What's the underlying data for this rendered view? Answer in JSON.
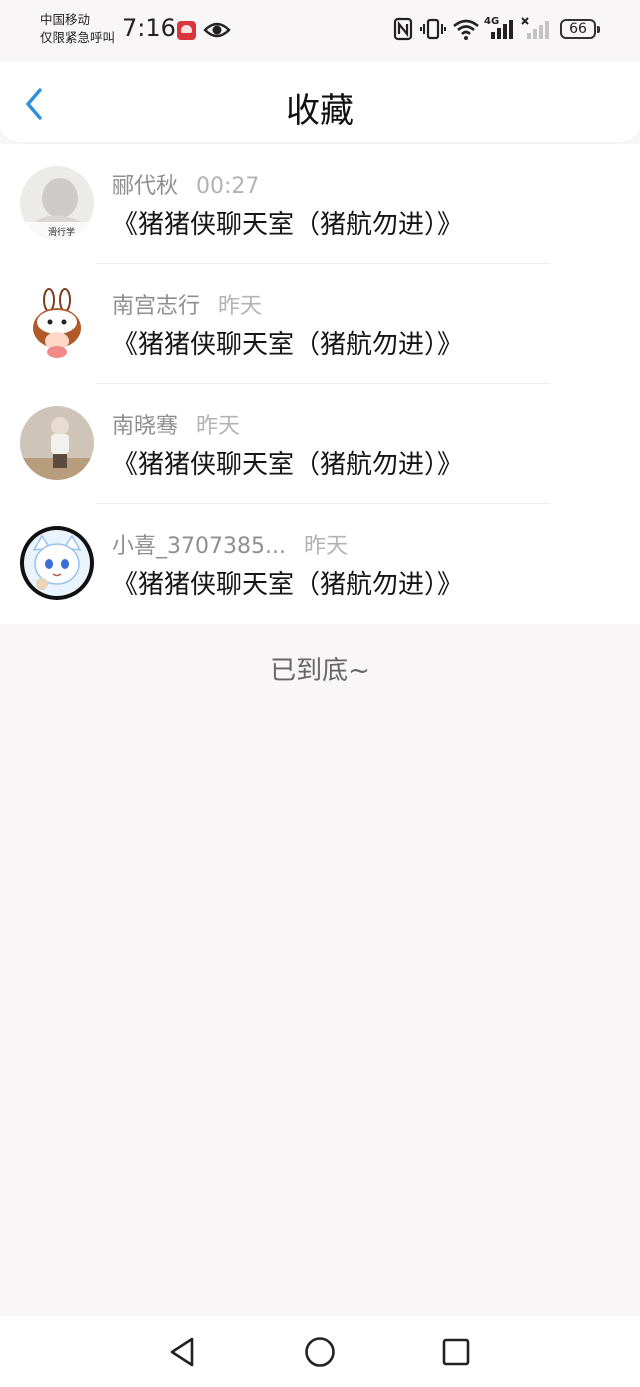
{
  "status_bar": {
    "carrier_line1": "中国移动",
    "carrier_line2": "仅限紧急呼叫",
    "time": "7:16",
    "network": "4G",
    "battery": "66"
  },
  "header": {
    "title": "收藏",
    "back_icon": "chevron-left-icon"
  },
  "favorites": [
    {
      "name": "郦代秋",
      "time": "00:27",
      "message": "《猪猪侠聊天室（猪航勿进）》"
    },
    {
      "name": "南宫志行",
      "time": "昨天",
      "message": "《猪猪侠聊天室（猪航勿进）》"
    },
    {
      "name": "南晓骞",
      "time": "昨天",
      "message": "《猪猪侠聊天室（猪航勿进）》"
    },
    {
      "name": "小喜_3707385...",
      "time": "昨天",
      "message": "《猪猪侠聊天室（猪航勿进）》"
    }
  ],
  "end_text": "已到底~",
  "nav": {
    "back_icon": "triangle-back-icon",
    "home_icon": "circle-home-icon",
    "recents_icon": "square-recents-icon"
  },
  "colors": {
    "accent": "#2b8fe0",
    "background": "#f8f6f7"
  }
}
